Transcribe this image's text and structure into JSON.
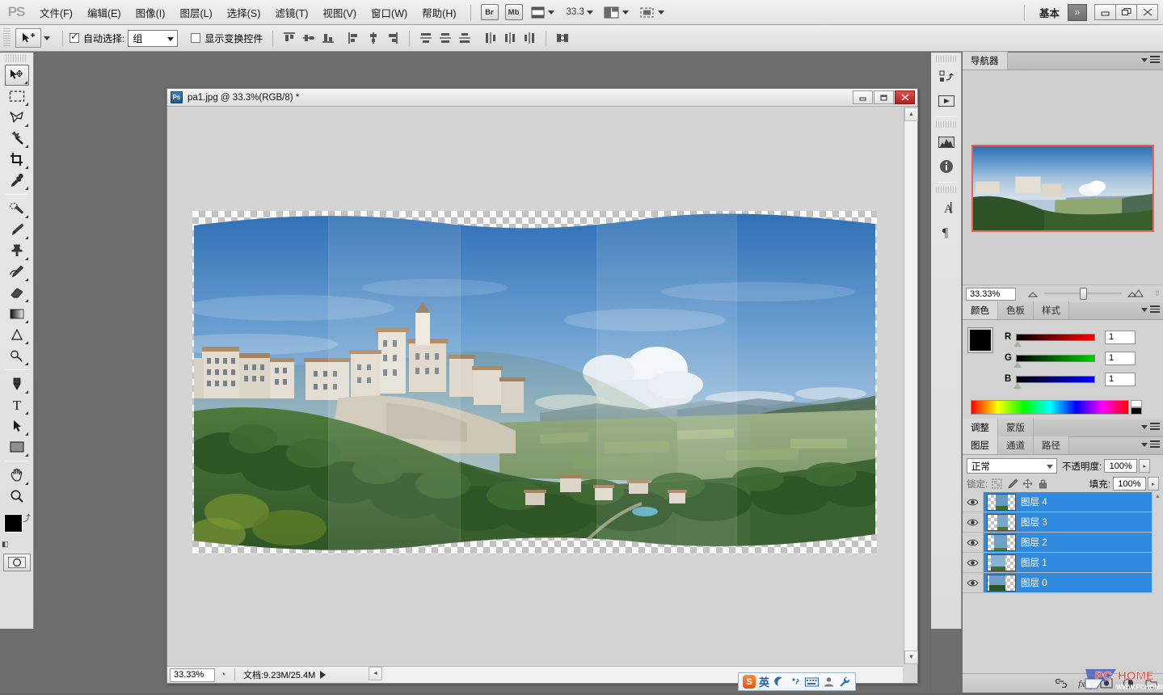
{
  "app": {
    "logo": "PS",
    "workspace_label": "基本",
    "chevron": "»"
  },
  "menu": {
    "items": [
      {
        "label": "文件(F)",
        "name": "menu-file"
      },
      {
        "label": "编辑(E)",
        "name": "menu-edit"
      },
      {
        "label": "图像(I)",
        "name": "menu-image"
      },
      {
        "label": "图层(L)",
        "name": "menu-layer"
      },
      {
        "label": "选择(S)",
        "name": "menu-select"
      },
      {
        "label": "滤镜(T)",
        "name": "menu-filter"
      },
      {
        "label": "视图(V)",
        "name": "menu-view"
      },
      {
        "label": "窗口(W)",
        "name": "menu-window"
      },
      {
        "label": "帮助(H)",
        "name": "menu-help"
      }
    ],
    "bridge_button": "Br",
    "minibridge_button": "Mb",
    "zoom_value": "33.3",
    "window_controls": {
      "minimize": "—",
      "restore": "❐",
      "close": "✕"
    }
  },
  "options_bar": {
    "auto_select_label": "自动选择:",
    "auto_select_checked": true,
    "auto_select_value": "组",
    "show_transform_label": "显示变换控件",
    "show_transform_checked": false,
    "align_icons": [
      "align-top-edges",
      "align-vertical-centers",
      "align-bottom-edges",
      "align-left-edges",
      "align-horizontal-centers",
      "align-right-edges",
      "distribute-top-edges",
      "distribute-vertical-centers",
      "distribute-bottom-edges",
      "distribute-left-edges",
      "distribute-horizontal-centers",
      "distribute-right-edges",
      "auto-align-layers"
    ]
  },
  "toolbar": {
    "tools": [
      {
        "name": "move-tool",
        "active": true
      },
      {
        "name": "rectangular-marquee-tool",
        "active": false
      },
      {
        "name": "lasso-tool",
        "active": false
      },
      {
        "name": "magic-wand-tool",
        "active": false
      },
      {
        "name": "crop-tool",
        "active": false
      },
      {
        "name": "eyedropper-tool",
        "active": false
      },
      {
        "name": "spot-healing-brush-tool",
        "active": false
      },
      {
        "name": "brush-tool",
        "active": false
      },
      {
        "name": "clone-stamp-tool",
        "active": false
      },
      {
        "name": "history-brush-tool",
        "active": false
      },
      {
        "name": "eraser-tool",
        "active": false
      },
      {
        "name": "gradient-tool",
        "active": false
      },
      {
        "name": "blur-tool",
        "active": false
      },
      {
        "name": "dodge-tool",
        "active": false
      },
      {
        "name": "pen-tool",
        "active": false
      },
      {
        "name": "horizontal-type-tool",
        "active": false
      },
      {
        "name": "path-selection-tool",
        "active": false
      },
      {
        "name": "rectangle-shape-tool",
        "active": false
      },
      {
        "name": "hand-tool",
        "active": false
      },
      {
        "name": "zoom-tool",
        "active": false
      }
    ],
    "foreground_color": "#000000",
    "background_color": "#000000"
  },
  "icon_dock": {
    "items": [
      {
        "name": "history-panel-icon"
      },
      {
        "name": "actions-panel-icon"
      },
      {
        "name": "histogram-panel-icon"
      },
      {
        "name": "info-panel-icon"
      },
      {
        "name": "character-panel-icon"
      },
      {
        "name": "paragraph-panel-icon"
      }
    ]
  },
  "document": {
    "title": "pa1.jpg @ 33.3%(RGB/8) *",
    "icon": "photoshop-document-icon",
    "window_controls": {
      "minimize": "—",
      "restore": "❐",
      "close": "✕"
    },
    "status": {
      "zoom": "33.33%",
      "doc_label": "文档:9.23M/25.4M"
    }
  },
  "navigator": {
    "tabs": [
      {
        "label": "导航器",
        "selected": true
      }
    ],
    "zoom_value": "33.33%",
    "zoom_out_icon": "zoom-out-icon",
    "zoom_in_icon": "zoom-in-icon",
    "view_box_color": "#e8645a"
  },
  "color_panel": {
    "tabs": [
      {
        "label": "颜色",
        "selected": true
      },
      {
        "label": "色板",
        "selected": false
      },
      {
        "label": "样式",
        "selected": false
      }
    ],
    "channels": [
      {
        "label": "R",
        "value": "1",
        "color": "#ff0000"
      },
      {
        "label": "G",
        "value": "1",
        "color": "#00c000"
      },
      {
        "label": "B",
        "value": "1",
        "color": "#0000ff"
      }
    ]
  },
  "adjust_panel": {
    "tabs": [
      {
        "label": "调整",
        "selected": true
      },
      {
        "label": "蒙版",
        "selected": false
      }
    ]
  },
  "layers_panel": {
    "tabs": [
      {
        "label": "图层",
        "selected": true
      },
      {
        "label": "通道",
        "selected": false
      },
      {
        "label": "路径",
        "selected": false
      }
    ],
    "blend_mode": "正常",
    "opacity_label": "不透明度:",
    "opacity_value": "100%",
    "lock_label": "锁定:",
    "fill_label": "填充:",
    "fill_value": "100%",
    "lock_icons": [
      {
        "name": "lock-transparent-pixels-icon"
      },
      {
        "name": "lock-image-pixels-icon"
      },
      {
        "name": "lock-position-icon"
      },
      {
        "name": "lock-all-icon"
      }
    ],
    "layers": [
      {
        "name": "图层 4",
        "visible": true,
        "selected": true
      },
      {
        "name": "图层 3",
        "visible": true,
        "selected": true
      },
      {
        "name": "图层 2",
        "visible": true,
        "selected": true
      },
      {
        "name": "图层 1",
        "visible": true,
        "selected": true
      },
      {
        "name": "图层 0",
        "visible": true,
        "selected": true
      }
    ],
    "footer_icons": [
      {
        "name": "link-layers-icon"
      },
      {
        "name": "layer-style-fx-icon"
      },
      {
        "name": "add-layer-mask-icon"
      },
      {
        "name": "new-adjustment-layer-icon"
      },
      {
        "name": "new-group-icon"
      }
    ]
  },
  "ime": {
    "logo": "S",
    "mode": "英",
    "icons": [
      {
        "name": "moon-icon"
      },
      {
        "name": "punctuation-icon"
      },
      {
        "name": "soft-keyboard-icon"
      },
      {
        "name": "user-icon"
      },
      {
        "name": "settings-wrench-icon"
      }
    ]
  },
  "watermark": {
    "brand": "PCHOME",
    "url": "WWW.PCHOME.NET"
  }
}
